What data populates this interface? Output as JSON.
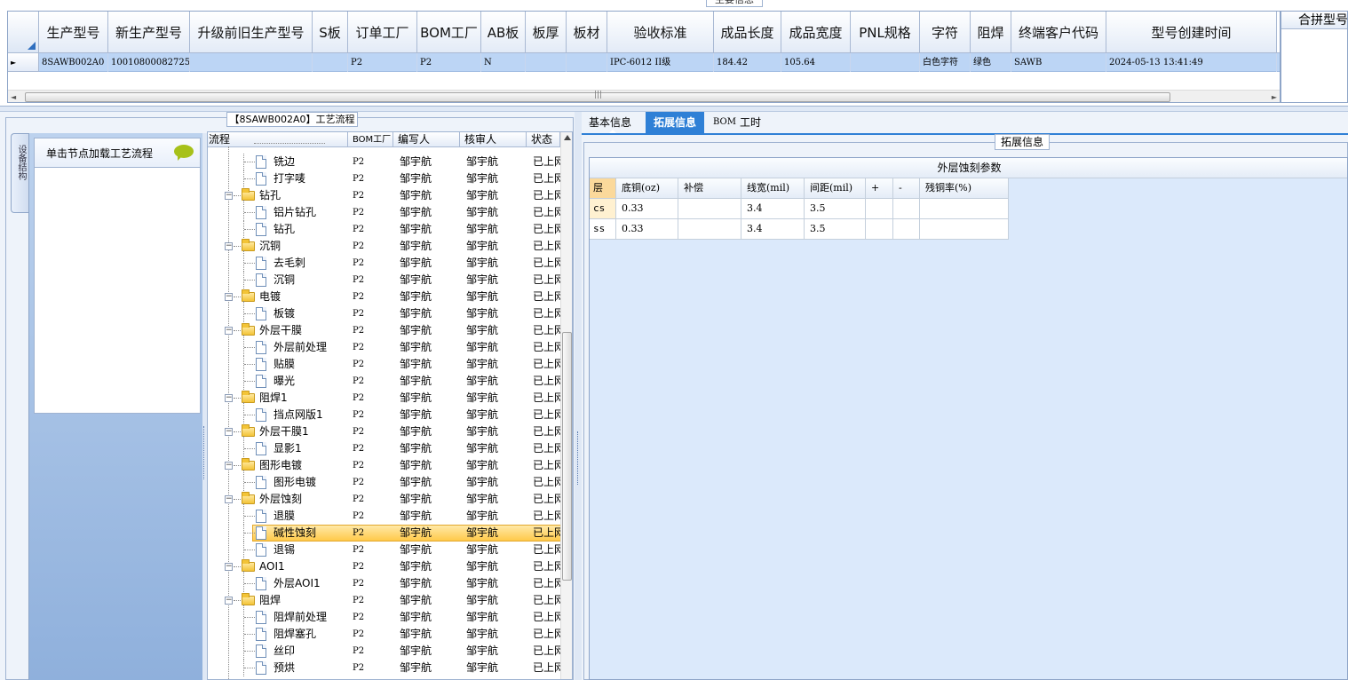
{
  "top_group_title": "主要信息",
  "top_grid": {
    "columns": [
      "生产型号",
      "新生产型号",
      "升级前旧生产型号",
      "S板",
      "订单工厂",
      "BOM工厂",
      "AB板",
      "板厚",
      "板材",
      "验收标准",
      "成品长度",
      "成品宽度",
      "PNL规格",
      "字符",
      "阻焊",
      "终端客户代码",
      "型号创建时间"
    ],
    "row": [
      "8SAWB002A0",
      "10010800082725",
      "",
      "",
      "P2",
      "P2",
      "N",
      "",
      "",
      "IPC-6012 II级",
      "184.42",
      "105.64",
      "",
      "白色字符",
      "绿色",
      "SAWB",
      "2024-05-13 13:41:49"
    ],
    "row_indicator": "►",
    "right_panel_title": "合拼型号"
  },
  "scrollbar": {
    "left_arrow": "◄",
    "right_arrow": "►",
    "thumb_grip": "|||"
  },
  "process_panel": {
    "title": "【8SAWB002A0】工艺流程",
    "side_tab": "设备结构",
    "click_hint": "单击节点加载工艺流程",
    "tree_headers": [
      "流程",
      "BOM工厂",
      "编写人",
      "核审人",
      "状态"
    ],
    "rows": [
      {
        "name": "铣边",
        "level": 2,
        "bom": "P2",
        "writer": "邹宇航",
        "reviewer": "邹宇航",
        "status": "已上网"
      },
      {
        "name": "打字唛",
        "level": 2,
        "bom": "P2",
        "writer": "邹宇航",
        "reviewer": "邹宇航",
        "status": "已上网"
      },
      {
        "name": "钻孔",
        "level": 1,
        "bom": "P2",
        "writer": "邹宇航",
        "reviewer": "邹宇航",
        "status": "已上网"
      },
      {
        "name": "铝片钻孔",
        "level": 2,
        "bom": "P2",
        "writer": "邹宇航",
        "reviewer": "邹宇航",
        "status": "已上网"
      },
      {
        "name": "钻孔",
        "level": 2,
        "bom": "P2",
        "writer": "邹宇航",
        "reviewer": "邹宇航",
        "status": "已上网"
      },
      {
        "name": "沉铜",
        "level": 1,
        "bom": "P2",
        "writer": "邹宇航",
        "reviewer": "邹宇航",
        "status": "已上网"
      },
      {
        "name": "去毛刺",
        "level": 2,
        "bom": "P2",
        "writer": "邹宇航",
        "reviewer": "邹宇航",
        "status": "已上网"
      },
      {
        "name": "沉铜",
        "level": 2,
        "bom": "P2",
        "writer": "邹宇航",
        "reviewer": "邹宇航",
        "status": "已上网"
      },
      {
        "name": "电镀",
        "level": 1,
        "bom": "P2",
        "writer": "邹宇航",
        "reviewer": "邹宇航",
        "status": "已上网"
      },
      {
        "name": "板镀",
        "level": 2,
        "bom": "P2",
        "writer": "邹宇航",
        "reviewer": "邹宇航",
        "status": "已上网"
      },
      {
        "name": "外层干膜",
        "level": 1,
        "bom": "P2",
        "writer": "邹宇航",
        "reviewer": "邹宇航",
        "status": "已上网"
      },
      {
        "name": "外层前处理",
        "level": 2,
        "bom": "P2",
        "writer": "邹宇航",
        "reviewer": "邹宇航",
        "status": "已上网"
      },
      {
        "name": "贴膜",
        "level": 2,
        "bom": "P2",
        "writer": "邹宇航",
        "reviewer": "邹宇航",
        "status": "已上网"
      },
      {
        "name": "曝光",
        "level": 2,
        "bom": "P2",
        "writer": "邹宇航",
        "reviewer": "邹宇航",
        "status": "已上网"
      },
      {
        "name": "阻焊1",
        "level": 1,
        "bom": "P2",
        "writer": "邹宇航",
        "reviewer": "邹宇航",
        "status": "已上网"
      },
      {
        "name": "挡点网版1",
        "level": 2,
        "bom": "P2",
        "writer": "邹宇航",
        "reviewer": "邹宇航",
        "status": "已上网"
      },
      {
        "name": "外层干膜1",
        "level": 1,
        "bom": "P2",
        "writer": "邹宇航",
        "reviewer": "邹宇航",
        "status": "已上网"
      },
      {
        "name": "显影1",
        "level": 2,
        "bom": "P2",
        "writer": "邹宇航",
        "reviewer": "邹宇航",
        "status": "已上网"
      },
      {
        "name": "图形电镀",
        "level": 1,
        "bom": "P2",
        "writer": "邹宇航",
        "reviewer": "邹宇航",
        "status": "已上网"
      },
      {
        "name": "图形电镀",
        "level": 2,
        "bom": "P2",
        "writer": "邹宇航",
        "reviewer": "邹宇航",
        "status": "已上网"
      },
      {
        "name": "外层蚀刻",
        "level": 1,
        "bom": "P2",
        "writer": "邹宇航",
        "reviewer": "邹宇航",
        "status": "已上网"
      },
      {
        "name": "退膜",
        "level": 2,
        "bom": "P2",
        "writer": "邹宇航",
        "reviewer": "邹宇航",
        "status": "已上网"
      },
      {
        "name": "碱性蚀刻",
        "level": 2,
        "bom": "P2",
        "writer": "邹宇航",
        "reviewer": "邹宇航",
        "status": "已上网",
        "selected": true
      },
      {
        "name": "退锡",
        "level": 2,
        "bom": "P2",
        "writer": "邹宇航",
        "reviewer": "邹宇航",
        "status": "已上网"
      },
      {
        "name": "AOI1",
        "level": 1,
        "bom": "P2",
        "writer": "邹宇航",
        "reviewer": "邹宇航",
        "status": "已上网"
      },
      {
        "name": "外层AOI1",
        "level": 2,
        "bom": "P2",
        "writer": "邹宇航",
        "reviewer": "邹宇航",
        "status": "已上网"
      },
      {
        "name": "阻焊",
        "level": 1,
        "bom": "P2",
        "writer": "邹宇航",
        "reviewer": "邹宇航",
        "status": "已上网"
      },
      {
        "name": "阻焊前处理",
        "level": 2,
        "bom": "P2",
        "writer": "邹宇航",
        "reviewer": "邹宇航",
        "status": "已上网"
      },
      {
        "name": "阻焊塞孔",
        "level": 2,
        "bom": "P2",
        "writer": "邹宇航",
        "reviewer": "邹宇航",
        "status": "已上网"
      },
      {
        "name": "丝印",
        "level": 2,
        "bom": "P2",
        "writer": "邹宇航",
        "reviewer": "邹宇航",
        "status": "已上网"
      },
      {
        "name": "预烘",
        "level": 2,
        "bom": "P2",
        "writer": "邹宇航",
        "reviewer": "邹宇航",
        "status": "已上网"
      }
    ]
  },
  "tabs": [
    "基本信息",
    "拓展信息",
    "BOM",
    "工时"
  ],
  "active_tab": 1,
  "ext_group_title": "拓展信息",
  "etch_table": {
    "title": "外层蚀刻参数",
    "headers": [
      "层",
      "底铜(oz)",
      "补偿",
      "线宽(mil)",
      "间距(mil)",
      "+",
      "-",
      "残铜率(%)"
    ],
    "rows": [
      [
        "cs",
        "0.33",
        "",
        "3.4",
        "3.5",
        "",
        "",
        ""
      ],
      [
        "ss",
        "0.33",
        "",
        "3.4",
        "3.5",
        "",
        "",
        ""
      ]
    ]
  },
  "colors": {
    "selection": "#ffd873",
    "row_highlight": "#bcd5f5",
    "accent_tab": "#2f80d6"
  }
}
